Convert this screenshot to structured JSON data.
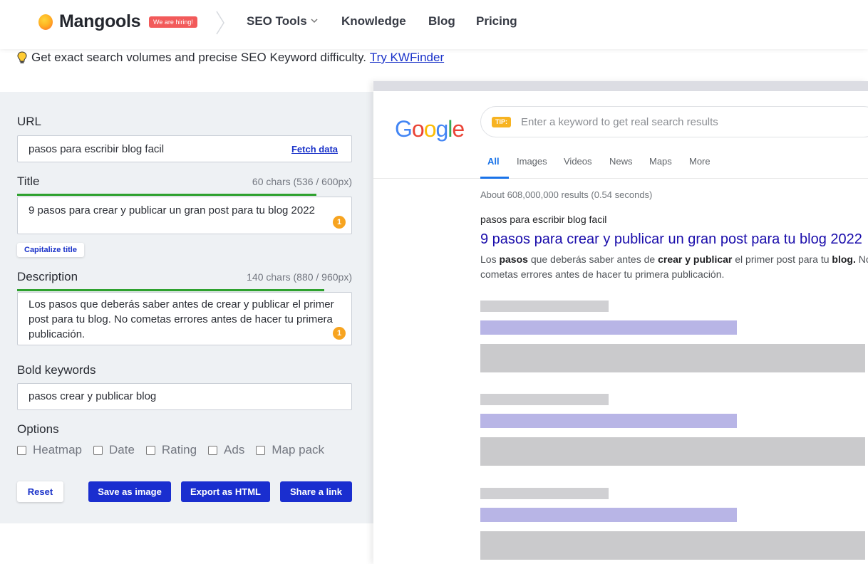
{
  "header": {
    "brand": "Mangools",
    "hiring_badge": "We are hiring!",
    "nav": {
      "seo_tools": "SEO Tools",
      "knowledge": "Knowledge",
      "blog": "Blog",
      "pricing": "Pricing"
    }
  },
  "promo": {
    "text": "Get exact search volumes and precise SEO Keyword difficulty.",
    "link": "Try KWFinder"
  },
  "form": {
    "url": {
      "label": "URL",
      "value": "pasos para escribir blog facil",
      "fetch_label": "Fetch data"
    },
    "title": {
      "label": "Title",
      "meta": "60 chars (536 / 600px)",
      "value": "9 pasos para crear y publicar un gran post para tu blog 2022",
      "warning_count": "1",
      "progress_fraction": 0.893
    },
    "capitalize_label": "Capitalize title",
    "description": {
      "label": "Description",
      "meta": "140 chars (880 / 960px)",
      "value": "Los pasos que deberás saber antes de crear y publicar el primer post para tu blog. No cometas errores antes de hacer tu primera publicación.",
      "warning_count": "1",
      "progress_fraction": 0.917
    },
    "bold_keywords": {
      "label": "Bold keywords",
      "value": "pasos crear y publicar blog"
    },
    "options": {
      "label": "Options",
      "items": [
        "Heatmap",
        "Date",
        "Rating",
        "Ads",
        "Map pack"
      ]
    },
    "buttons": {
      "reset": "Reset",
      "save": "Save as image",
      "export": "Export as HTML",
      "share": "Share a link"
    }
  },
  "serp": {
    "tip_badge": "TIP:",
    "search_placeholder": "Enter a keyword to get real search results",
    "tabs": [
      "All",
      "Images",
      "Videos",
      "News",
      "Maps",
      "More"
    ],
    "active_tab": "All",
    "results_count": "About 608,000,000 results (0.54 seconds)",
    "result": {
      "url": "pasos para escribir blog facil",
      "title": "9 pasos para crear y publicar un gran post para tu blog 2022",
      "description_parts": [
        {
          "t": "Los ",
          "b": false
        },
        {
          "t": "pasos",
          "b": true
        },
        {
          "t": " que deberás saber antes de ",
          "b": false
        },
        {
          "t": "crear y publicar",
          "b": true
        },
        {
          "t": " el primer post para tu ",
          "b": false
        },
        {
          "t": "blog.",
          "b": true
        },
        {
          "t": " No cometas errores antes de hacer tu primera publicación.",
          "b": false
        }
      ]
    }
  },
  "colors": {
    "primary_button": "#1a2ecf",
    "link": "#1a32c9",
    "progress_good": "#2ea12e",
    "warning": "#f7a420",
    "serp_title": "#1a0dab"
  }
}
